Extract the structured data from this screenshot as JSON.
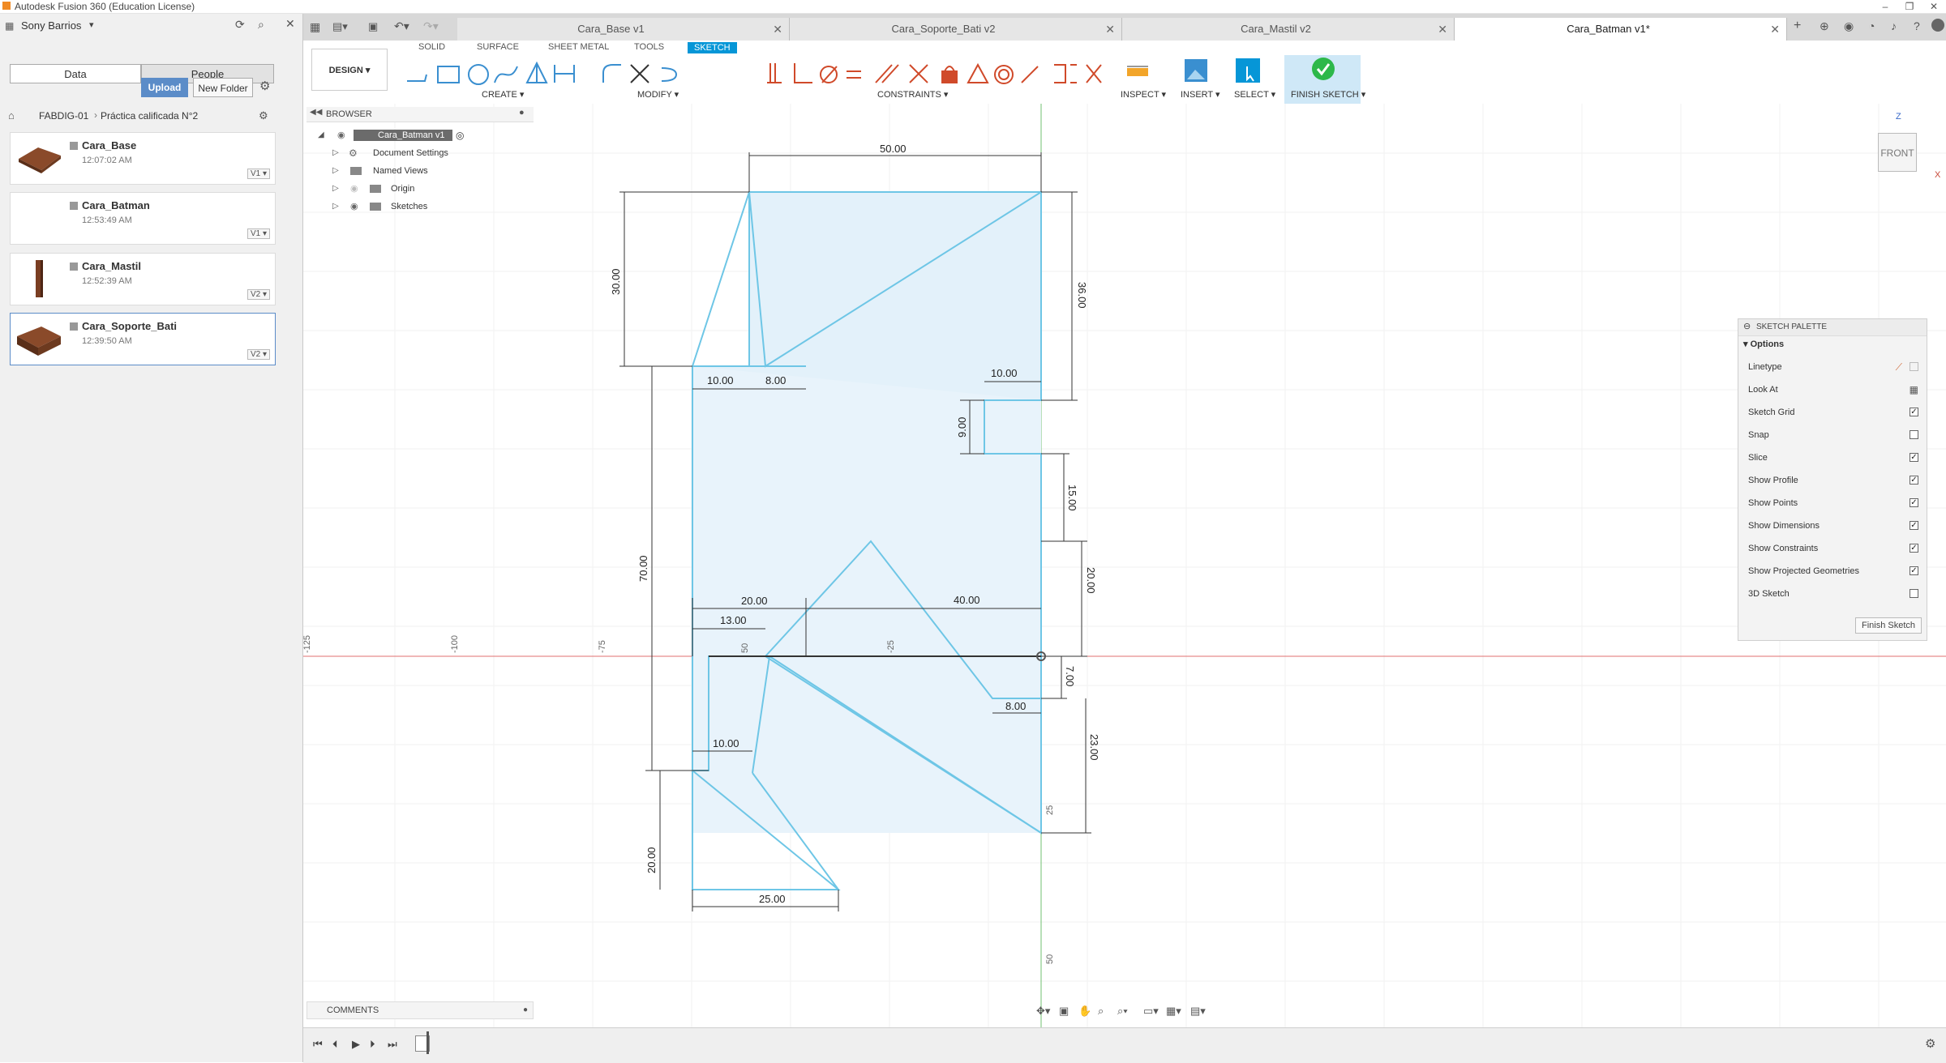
{
  "app": {
    "title": "Autodesk Fusion 360 (Education License)"
  },
  "left_panel": {
    "user": "Sony Barrios",
    "tabs": [
      "Data",
      "People"
    ],
    "upload_label": "Upload",
    "new_folder_label": "New Folder",
    "breadcrumb": [
      "FABDIG-01",
      "Práctica calificada N°2"
    ],
    "files": [
      {
        "name": "Cara_Base",
        "time": "12:07:02 AM",
        "version": "V1"
      },
      {
        "name": "Cara_Batman",
        "time": "12:53:49 AM",
        "version": "V1"
      },
      {
        "name": "Cara_Mastil",
        "time": "12:52:39 AM",
        "version": "V2"
      },
      {
        "name": "Cara_Soporte_Bati",
        "time": "12:39:50 AM",
        "version": "V2"
      }
    ]
  },
  "doc_tabs": [
    {
      "label": "Cara_Base v1"
    },
    {
      "label": "Cara_Soporte_Bati v2"
    },
    {
      "label": "Cara_Mastil v2"
    },
    {
      "label": "Cara_Batman v1*"
    }
  ],
  "ribbon": {
    "workspace": "DESIGN",
    "tabs": [
      "SOLID",
      "SURFACE",
      "SHEET METAL",
      "TOOLS",
      "SKETCH"
    ],
    "groups": [
      "CREATE",
      "MODIFY",
      "CONSTRAINTS",
      "INSPECT",
      "INSERT",
      "SELECT",
      "FINISH SKETCH"
    ]
  },
  "browser": {
    "title": "BROWSER",
    "root": "Cara_Batman v1",
    "items": [
      "Document Settings",
      "Named Views",
      "Origin",
      "Sketches"
    ]
  },
  "viewcube": {
    "face": "FRONT",
    "z_axis": "Z",
    "x_axis": "X"
  },
  "sketch_palette": {
    "title": "SKETCH PALETTE",
    "section": "Options",
    "linetype_label": "Linetype",
    "look_at_label": "Look At",
    "options": [
      {
        "label": "Sketch Grid",
        "checked": true,
        "mark": "✓"
      },
      {
        "label": "Snap",
        "checked": false,
        "mark": ""
      },
      {
        "label": "Slice",
        "checked": true,
        "mark": "✓"
      },
      {
        "label": "Show Profile",
        "checked": true,
        "mark": "✓"
      },
      {
        "label": "Show Points",
        "checked": true,
        "mark": "✓"
      },
      {
        "label": "Show Dimensions",
        "checked": true,
        "mark": "✓"
      },
      {
        "label": "Show Constraints",
        "checked": true,
        "mark": "✓"
      },
      {
        "label": "Show Projected Geometries",
        "checked": true,
        "mark": "✓"
      },
      {
        "label": "3D Sketch",
        "checked": false,
        "mark": ""
      }
    ],
    "finish_label": "Finish Sketch"
  },
  "comments": {
    "label": "COMMENTS"
  },
  "axis_ticks": {
    "h": [
      "-125",
      "-100",
      "-75",
      "-25"
    ],
    "v": [
      "25",
      "50"
    ],
    "origin_label": "50"
  },
  "dimensions": [
    "50.00",
    "30.00",
    "36.00",
    "10.00",
    "8.00",
    "10.00",
    "9.00",
    "15.00",
    "20.00",
    "20.00",
    "40.00",
    "13.00",
    "70.00",
    "7.00",
    "8.00",
    "23.00",
    "10.00",
    "20.00",
    "25.00"
  ],
  "colors": {
    "accent": "#0696d7",
    "sketch_line": "#6ec6e6",
    "profile_fill": "#e3f1fa",
    "x_axis": "#e07070",
    "y_axis": "#70c070"
  }
}
